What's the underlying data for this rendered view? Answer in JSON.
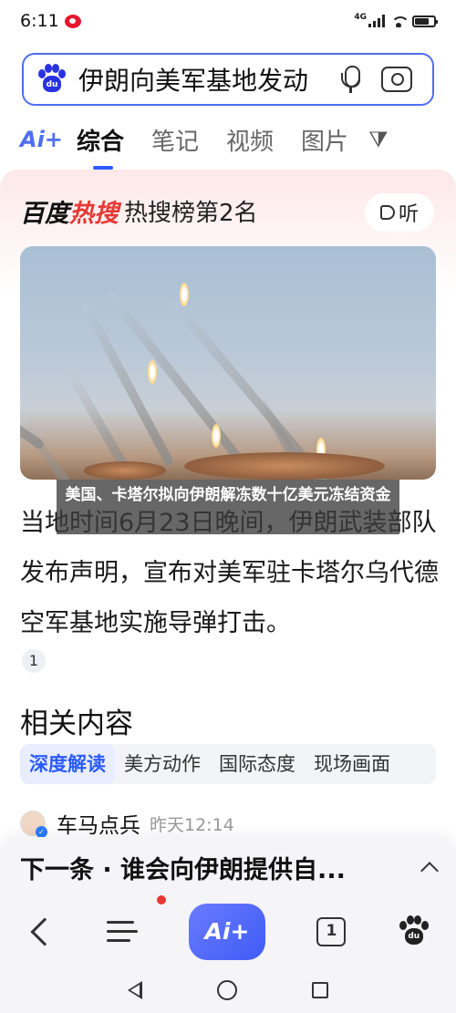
{
  "status_bar": {
    "time": "6:11",
    "network": "4G",
    "icons": [
      "weibo-icon",
      "signal-icon",
      "wifi-icon",
      "battery-icon"
    ]
  },
  "search": {
    "query": "伊朗向美军基地发动",
    "icons": [
      "baidu-paw-icon",
      "microphone-icon",
      "camera-icon"
    ]
  },
  "tabs": {
    "ai_label": "Ai+",
    "items": [
      "综合",
      "笔记",
      "视频",
      "图片"
    ],
    "active": "综合",
    "filter_icon": "filter-icon"
  },
  "hot_search": {
    "logo_part1": "百度",
    "logo_part2": "热搜",
    "rank": "热搜榜第2名",
    "listen_label": "听"
  },
  "news_image": {
    "caption": "美国、卡塔尔拟向伊朗解冻数十亿美元冻结资金"
  },
  "article": {
    "body": "当地时间6月23日晚间，伊朗武装部队发布声明，宣布对美军驻卡塔尔乌代德空军基地实施导弹打击。",
    "reference_number": "1"
  },
  "related": {
    "title": "相关内容",
    "chips": [
      "深度解读",
      "美方动作",
      "国际态度",
      "现场画面"
    ],
    "active_chip": "深度解读",
    "author": "车马点兵",
    "author_time": "昨天12:14"
  },
  "next_bar": {
    "text": "下一条 · 谁会向伊朗提供自..."
  },
  "bottom_nav": {
    "ai_label": "Ai+",
    "tab_count": "1"
  },
  "colors": {
    "accent": "#4e6ef2",
    "hot_red": "#e53935",
    "card_pink": "#fde8e8"
  }
}
